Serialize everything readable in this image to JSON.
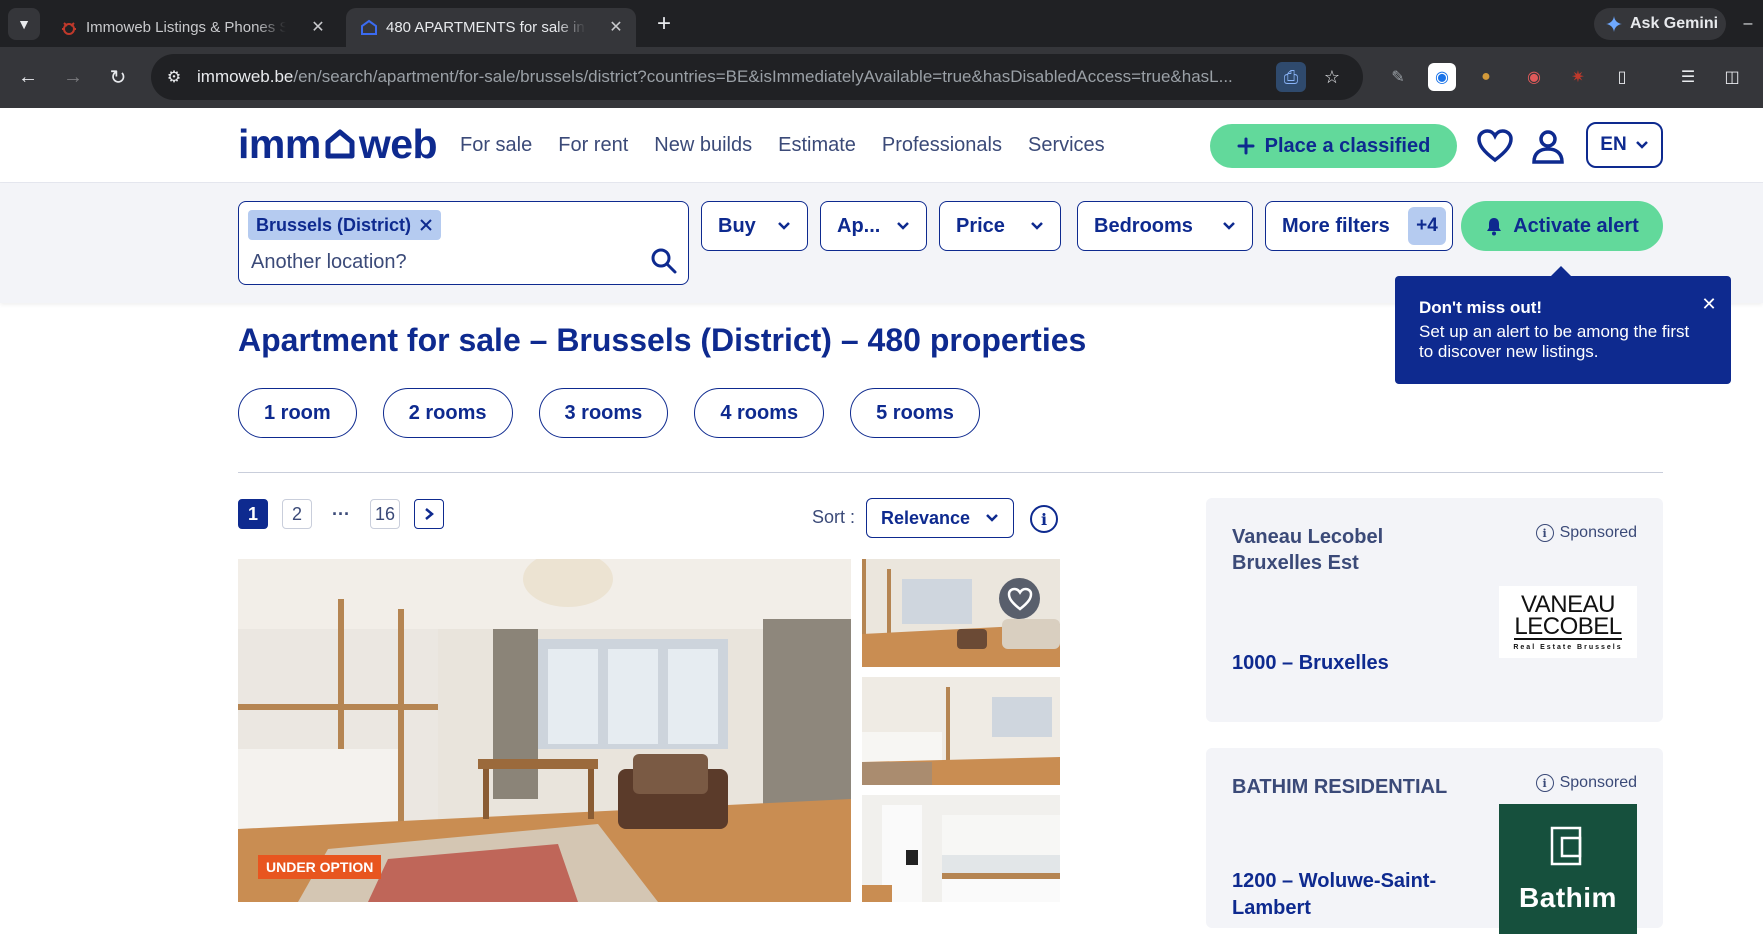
{
  "browser": {
    "tabs": [
      {
        "title": "Immoweb Listings & Phones Se",
        "active": false
      },
      {
        "title": "480 APARTMENTS for sale in Br",
        "active": true
      }
    ],
    "ask_gemini": "Ask Gemini",
    "url_host": "immoweb.be",
    "url_path": "/en/search/apartment/for-sale/brussels/district?countries=BE&isImmediatelyAvailable=true&hasDisabledAccess=true&hasL..."
  },
  "header": {
    "logo_left": "imm",
    "logo_right": "web",
    "nav": [
      "For sale",
      "For rent",
      "New builds",
      "Estimate",
      "Professionals",
      "Services"
    ],
    "place_classified": "Place a classified",
    "language": "EN"
  },
  "filters": {
    "location_chip": "Brussels (District)",
    "location_placeholder": "Another location?",
    "transaction": "Buy",
    "property_type": "Ap...",
    "price": "Price",
    "bedrooms": "Bedrooms",
    "more_filters": "More filters",
    "more_filters_count": "+4",
    "activate_alert": "Activate alert"
  },
  "tooltip": {
    "title": "Don't miss out!",
    "text": "Set up an alert to be among the first to discover new listings."
  },
  "results": {
    "title": "Apartment for sale – Brussels (District) – 480 properties",
    "room_pills": [
      "1 room",
      "2 rooms",
      "3 rooms",
      "4 rooms",
      "5 rooms"
    ],
    "pagination": {
      "current": "1",
      "second": "2",
      "ellipsis": "···",
      "last": "16"
    },
    "sort_label": "Sort :",
    "sort_value": "Relevance"
  },
  "listing": {
    "badge": "UNDER OPTION"
  },
  "sponsored": [
    {
      "name": "Vaneau Lecobel Bruxelles Est",
      "tag": "Sponsored",
      "address": "1000 – Bruxelles",
      "logo_line1": "VANEAU",
      "logo_line2": "LECOBEL",
      "logo_line3": "Real Estate Brussels"
    },
    {
      "name": "BATHIM RESIDENTIAL",
      "tag": "Sponsored",
      "address": "1200 – Woluwe-Saint-Lambert",
      "logo_text": "Bathim"
    }
  ],
  "colors": {
    "brand_blue": "#0e2a8f",
    "accent_green": "#62d99b",
    "badge_orange": "#e8551f"
  }
}
